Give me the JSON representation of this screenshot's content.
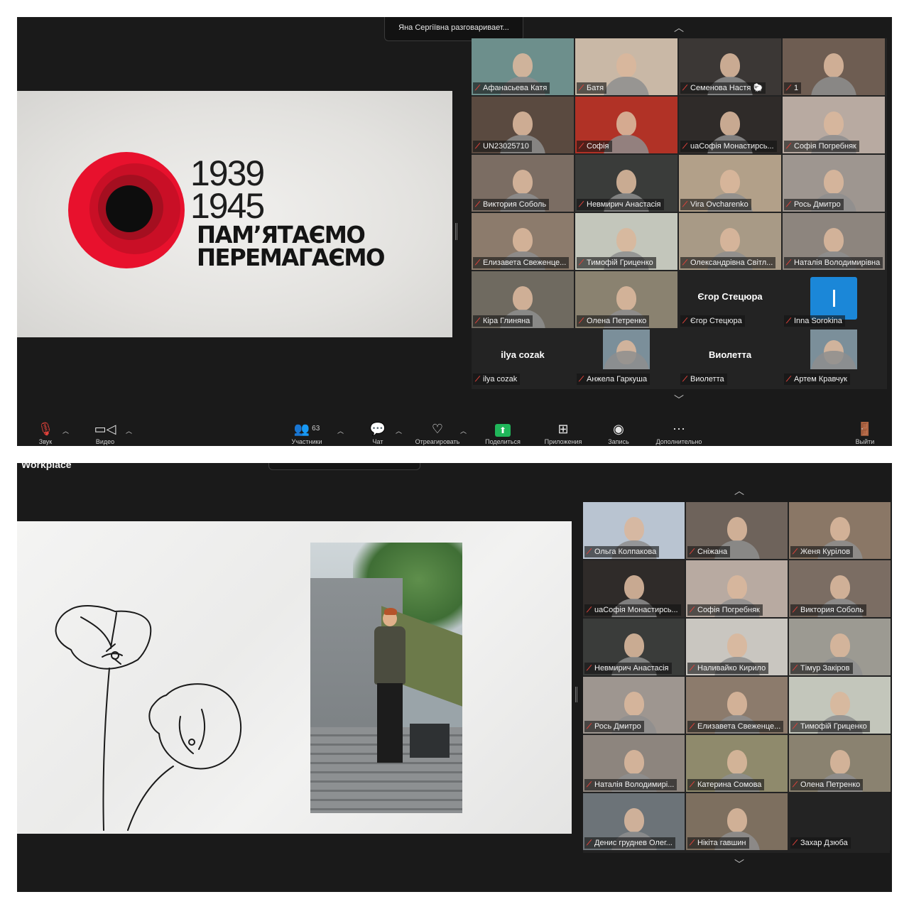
{
  "shot1": {
    "speaking_banner": "Яна Сергіївна разговаривает...",
    "slide": {
      "year_start": "1939",
      "year_end": "1945",
      "slogan_line1": "ПАМ’ЯТАЄМО",
      "slogan_line2": "ПЕРЕМАГАЄМО"
    },
    "participants": [
      {
        "name": "Афанасьева Катя",
        "bg": "#6d8f8c"
      },
      {
        "name": "Батя",
        "bg": "#c9b8a6"
      },
      {
        "name": "Семенова Настя 🐑",
        "bg": "#3b3735"
      },
      {
        "name": "1",
        "bg": "#6e5d52"
      },
      {
        "name": "UN23025710",
        "bg": "#5a4a40"
      },
      {
        "name": "Софія",
        "bg": "#b13226"
      },
      {
        "name": "uaСофія Монастирсь...",
        "bg": "#2f2b29"
      },
      {
        "name": "Софія Погребняк",
        "bg": "#b8aaa1"
      },
      {
        "name": "Виктория Соболь",
        "bg": "#7b6d63"
      },
      {
        "name": "Невмирич Анастасія",
        "bg": "#3a3c3a"
      },
      {
        "name": "Vira Ovcharenko",
        "bg": "#b2a089"
      },
      {
        "name": "Рось Дмитро",
        "bg": "#9e9690"
      },
      {
        "name": "Елизавета Свеженце...",
        "bg": "#8c7b6c"
      },
      {
        "name": "Тимофій Гриценко",
        "bg": "#c3c6bb"
      },
      {
        "name": "Олександрівна Світл...",
        "bg": "#a89a86"
      },
      {
        "name": "Наталія Володимирівна",
        "bg": "#8d857e"
      },
      {
        "name": "Кіра Глиняна",
        "bg": "#6f6a60"
      },
      {
        "name": "Олена Петренко",
        "bg": "#8a8270"
      },
      {
        "name": "Єгор Стецюра",
        "bg": "#232323",
        "display": "Єгор Стецюра"
      },
      {
        "name": "Inna Sorokina",
        "bg": "#232323",
        "avatar": true
      },
      {
        "name": "ilya cozak",
        "bg": "#232323",
        "display": "ilya cozak"
      },
      {
        "name": "Анжела Гаркуша",
        "bg": "#232323",
        "photo": true
      },
      {
        "name": "Виолетта",
        "bg": "#232323",
        "display": "Виолетта"
      },
      {
        "name": "Артем Кравчук",
        "bg": "#232323",
        "photo": true
      }
    ],
    "toolbar": {
      "audio": "Звук",
      "video": "Видео",
      "participants": "Участники",
      "participants_count": "63",
      "chat": "Чат",
      "react": "Отреагировать",
      "share": "Поделиться",
      "apps": "Приложения",
      "record": "Запись",
      "more": "Дополнительно",
      "leave": "Выйти"
    }
  },
  "shot2": {
    "app_title": "Workplace",
    "participants": [
      {
        "name": "Ольга Колпакова",
        "bg": "#b9c4d1"
      },
      {
        "name": "Сніжана",
        "bg": "#6e635b"
      },
      {
        "name": "Женя Курілов",
        "bg": "#8a7766"
      },
      {
        "name": "uaСофія Монастирсь...",
        "bg": "#2f2b29"
      },
      {
        "name": "Софія Погребняк",
        "bg": "#b8aaa1"
      },
      {
        "name": "Виктория Соболь",
        "bg": "#7b6d63"
      },
      {
        "name": "Невмирич Анастасія",
        "bg": "#3a3c3a"
      },
      {
        "name": "Наливайко Кирило",
        "bg": "#c9c6c0"
      },
      {
        "name": "Тімур Закіров",
        "bg": "#9c9a92"
      },
      {
        "name": "Рось Дмитро",
        "bg": "#9e9690"
      },
      {
        "name": "Елизавета Свеженце...",
        "bg": "#8c7b6c"
      },
      {
        "name": "Тимофій Гриценко",
        "bg": "#c3c6bb"
      },
      {
        "name": "Наталія Володимирі...",
        "bg": "#8d857e"
      },
      {
        "name": "Катерина Сомова",
        "bg": "#8f8a6c"
      },
      {
        "name": "Олена Петренко",
        "bg": "#8a8270"
      },
      {
        "name": "Денис груднев Олег...",
        "bg": "#6c7378"
      },
      {
        "name": "Нікіта гавшин",
        "bg": "#7d6f5f"
      },
      {
        "name": "Захар Дзюба",
        "bg": "#232323"
      }
    ]
  },
  "colors": {
    "poppy_red": "#e8112d",
    "poppy_dark": "#a40f20",
    "share_green": "#20b65a",
    "mic_muted": "#e0413a"
  }
}
